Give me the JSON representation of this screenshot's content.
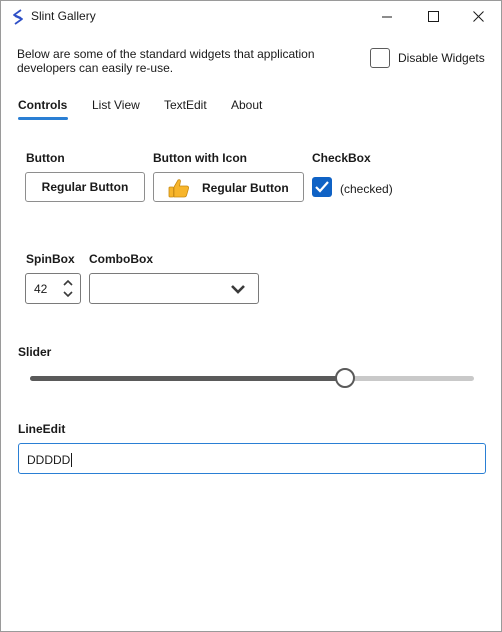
{
  "window": {
    "title": "Slint Gallery"
  },
  "header": {
    "intro": "Below are some of the standard widgets that application developers can easily re-use.",
    "disable_widgets_label": "Disable Widgets",
    "disable_widgets_checked": false
  },
  "tabs": [
    {
      "label": "Controls",
      "active": true
    },
    {
      "label": "List View",
      "active": false
    },
    {
      "label": "TextEdit",
      "active": false
    },
    {
      "label": "About",
      "active": false
    }
  ],
  "controls": {
    "button": {
      "section_label": "Button",
      "label": "Regular Button"
    },
    "button_with_icon": {
      "section_label": "Button with Icon",
      "label": "Regular Button",
      "icon": "thumbs-up-icon"
    },
    "checkbox": {
      "section_label": "CheckBox",
      "label": "(checked)",
      "checked": true
    },
    "spinbox": {
      "section_label": "SpinBox",
      "value": "42"
    },
    "combobox": {
      "section_label": "ComboBox",
      "value": ""
    },
    "slider": {
      "section_label": "Slider",
      "value_fraction": 0.71
    },
    "lineedit": {
      "section_label": "LineEdit",
      "value": "DDDDD"
    }
  },
  "colors": {
    "accent": "#2a7fd4",
    "checkbox_fill": "#0f62c5"
  }
}
